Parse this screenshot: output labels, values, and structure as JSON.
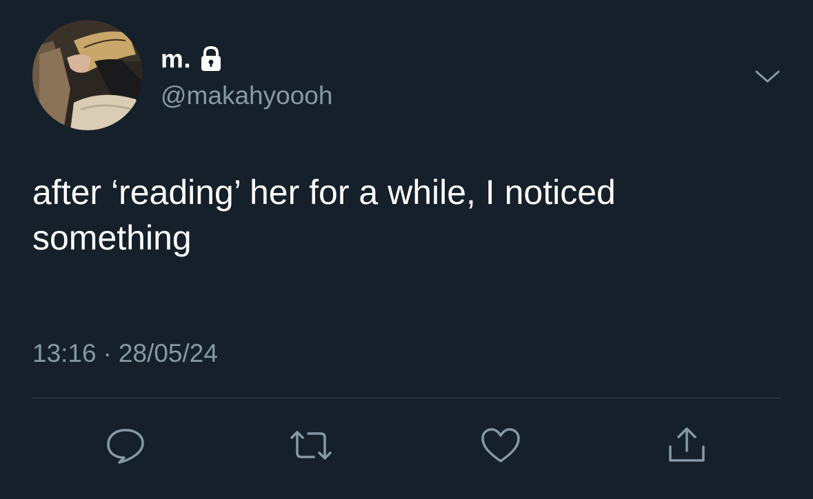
{
  "user": {
    "display_name": "m.",
    "handle": "@makahyoooh",
    "protected_icon": "lock-icon",
    "avatar_icon": "profile-photo"
  },
  "tweet": {
    "text": "after ‘reading’ her for a while, I noticed\nsomething",
    "time": "13:16",
    "separator": "·",
    "date": "28/05/24"
  },
  "menu_icon": "chevron-down-icon",
  "actions": [
    {
      "name": "reply",
      "icon": "reply-icon"
    },
    {
      "name": "retweet",
      "icon": "retweet-icon"
    },
    {
      "name": "like",
      "icon": "heart-icon"
    },
    {
      "name": "share",
      "icon": "share-icon"
    }
  ],
  "colors": {
    "background": "#15202b",
    "primary_text": "#ffffff",
    "secondary_text": "#8899a6",
    "divider": "#38444d"
  }
}
